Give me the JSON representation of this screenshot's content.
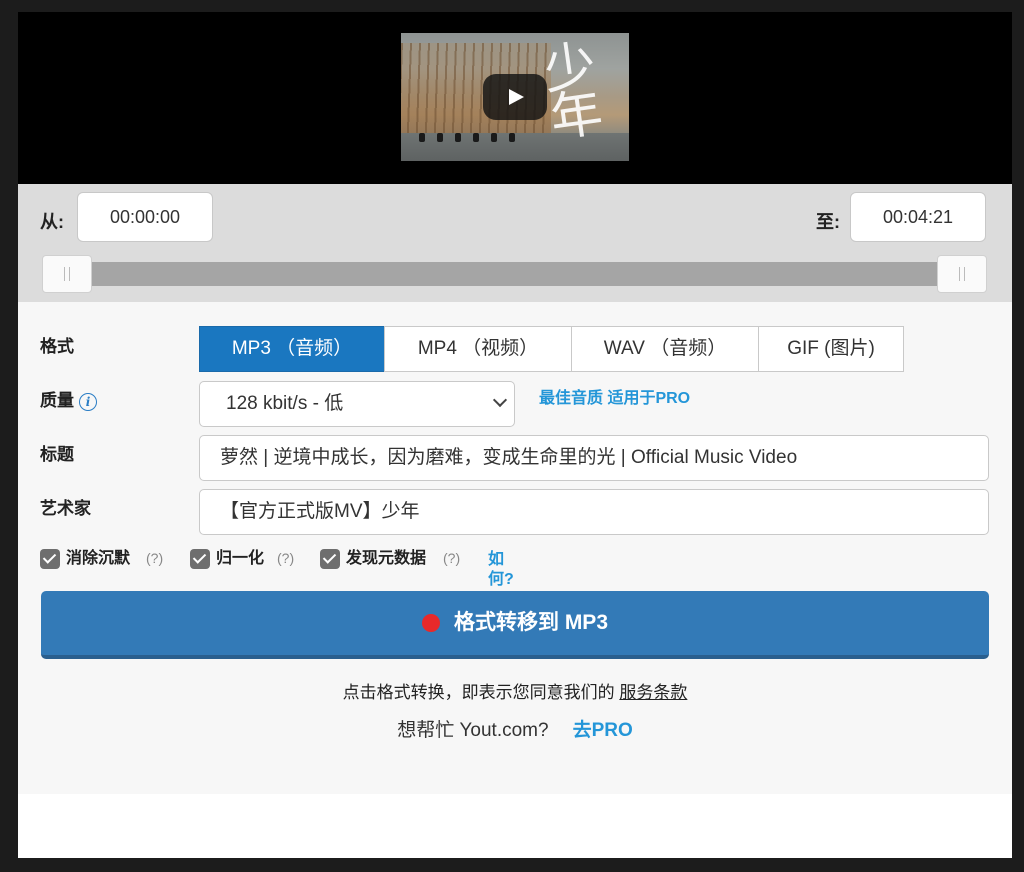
{
  "video": {
    "logo_text": "少年"
  },
  "trim": {
    "from_label": "从:",
    "start_time": "00:00:00",
    "to_label": "至:",
    "end_time": "00:04:21"
  },
  "format": {
    "label": "格式",
    "tabs": [
      {
        "label": "MP3 （音频）",
        "active": true
      },
      {
        "label": "MP4 （视频）",
        "active": false
      },
      {
        "label": "WAV （音频）",
        "active": false
      },
      {
        "label": "GIF (图片)",
        "active": false
      }
    ]
  },
  "quality": {
    "label": "质量",
    "info_icon": "ⓘ",
    "selected": "128 kbit/s - 低",
    "pro_link": "最佳音质 适用于PRO"
  },
  "title_field": {
    "label": "标题",
    "value": "萝然 | 逆境中成长，因为磨难，变成生命里的光 | Official Music Video"
  },
  "artist_field": {
    "label": "艺术家",
    "value": "【官方正式版MV】少年"
  },
  "options": [
    {
      "label": "消除沉默",
      "help": "(?)",
      "checked": true
    },
    {
      "label": "归一化",
      "help": "(?)",
      "checked": true
    },
    {
      "label": "发现元数据",
      "help": "(?)",
      "checked": true
    }
  ],
  "how_link": "如何?",
  "convert_button": "格式转移到 MP3",
  "terms": {
    "text": "点击格式转换，即表示您同意我们的",
    "link": "服务条款"
  },
  "help": {
    "text": "想帮忙 Yout.com?",
    "link": "去PRO"
  },
  "colors": {
    "accent": "#1a77c0",
    "button": "#337ab7",
    "link": "#2496d8",
    "record": "#e8292a"
  }
}
